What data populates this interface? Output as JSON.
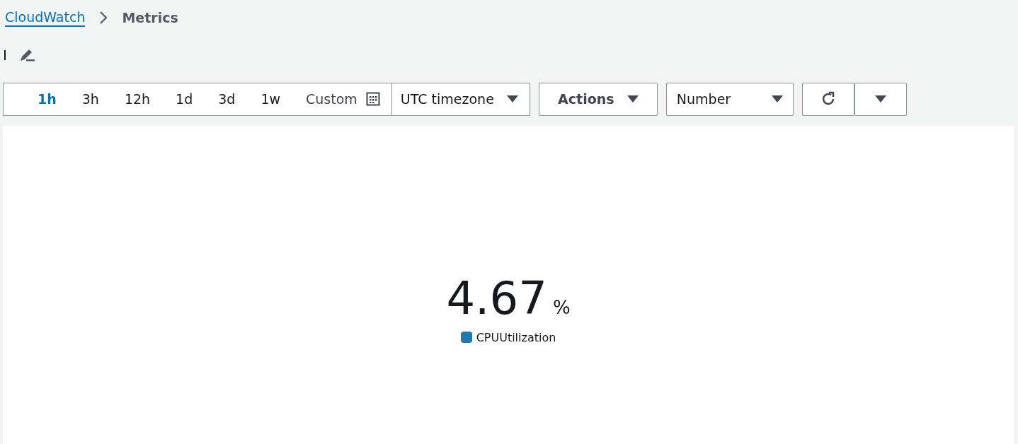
{
  "breadcrumb": {
    "link": "CloudWatch",
    "current": "Metrics"
  },
  "time_ranges": [
    {
      "label": "1h",
      "selected": true
    },
    {
      "label": "3h",
      "selected": false
    },
    {
      "label": "12h",
      "selected": false
    },
    {
      "label": "1d",
      "selected": false
    },
    {
      "label": "3d",
      "selected": false
    },
    {
      "label": "1w",
      "selected": false
    }
  ],
  "custom": "Custom",
  "timezone": "UTC timezone",
  "actions": "Actions",
  "view_type": "Number",
  "widget": {
    "value": "4.67",
    "unit": "%",
    "legend": [
      {
        "label": "CPUUtilization",
        "color": "#1f77b4"
      }
    ]
  }
}
